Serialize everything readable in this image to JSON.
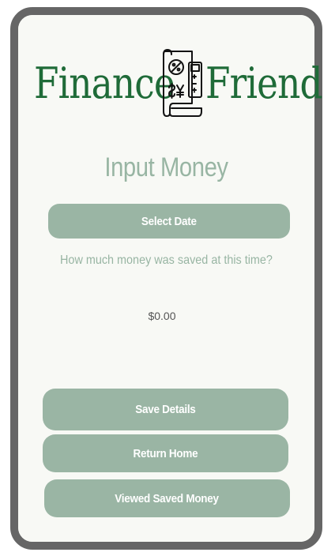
{
  "header": {
    "brand_left": "Finance",
    "brand_right": "Friend",
    "logo_icon": "receipt-calculator-icon"
  },
  "main": {
    "title": "Input Money",
    "select_date_label": "Select Date",
    "question": "How much money was saved at this time?",
    "amount_placeholder": "$0.00"
  },
  "actions": {
    "save_label": "Save Details",
    "home_label": "Return Home",
    "viewed_label": "Viewed Saved Money"
  },
  "colors": {
    "brand_green": "#1f6b38",
    "accent_sage": "#9ab5a4",
    "frame": "#666666",
    "background": "#f8f9f5"
  }
}
